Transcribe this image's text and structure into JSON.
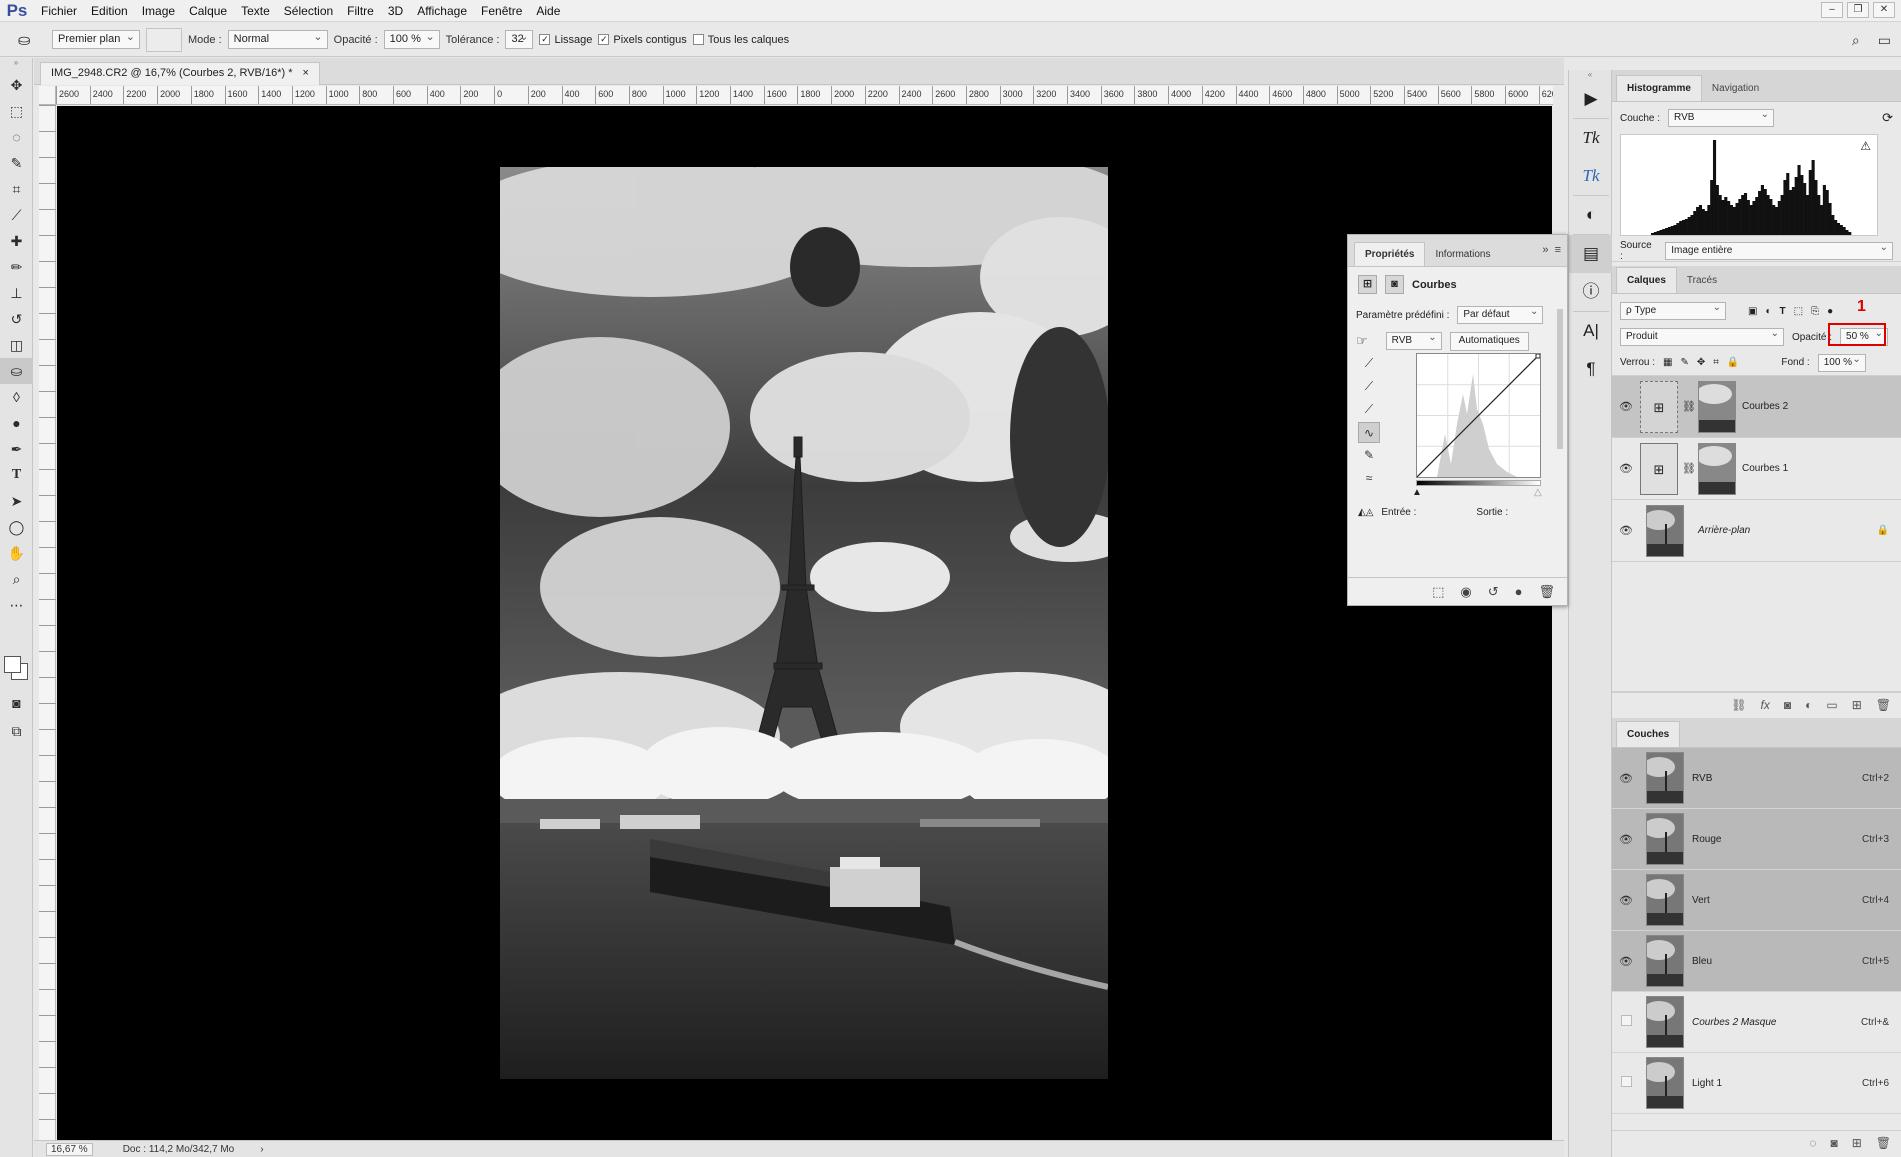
{
  "app": {
    "logo": "Ps",
    "menu": [
      "Fichier",
      "Edition",
      "Image",
      "Calque",
      "Texte",
      "Sélection",
      "Filtre",
      "3D",
      "Affichage",
      "Fenêtre",
      "Aide"
    ],
    "window_controls": [
      "–",
      "❐",
      "✕"
    ]
  },
  "options": {
    "fill_source": "Premier plan",
    "mode_label": "Mode :",
    "mode_value": "Normal",
    "opacity_label": "Opacité :",
    "opacity_value": "100 %",
    "tolerance_label": "Tolérance :",
    "tolerance_value": "32",
    "lissage": "Lissage",
    "pixels_contigus": "Pixels contigus",
    "tous_calques": "Tous les calques"
  },
  "document": {
    "tab_title": "IMG_2948.CR2 @ 16,7% (Courbes 2, RVB/16*) *",
    "close": "×",
    "ruler_labels": [
      "2600",
      "2400",
      "2200",
      "2000",
      "1800",
      "1600",
      "1400",
      "1200",
      "1000",
      "800",
      "600",
      "400",
      "200",
      "0",
      "200",
      "400",
      "600",
      "800",
      "1000",
      "1200",
      "1400",
      "1600",
      "1800",
      "2000",
      "2200",
      "2400",
      "2600",
      "2800",
      "3000",
      "3200",
      "3400",
      "3600",
      "3800",
      "4000",
      "4200",
      "4400",
      "4600",
      "4800",
      "5000",
      "5200",
      "5400",
      "5600",
      "5800",
      "6000",
      "620"
    ],
    "zoom": "16,67 %",
    "doc_info": "Doc : 114,2 Mo/342,7 Mo",
    "doc_arrow": "›"
  },
  "properties": {
    "tabs": [
      "Propriétés",
      "Informations"
    ],
    "title": "Courbes",
    "preset_label": "Paramètre prédéfini :",
    "preset_value": "Par défaut",
    "channel": "RVB",
    "auto_button": "Automatiques",
    "input_label": "Entrée :",
    "output_label": "Sortie :"
  },
  "histogram": {
    "tabs": [
      "Histogramme",
      "Navigation"
    ],
    "channel_label": "Couche :",
    "channel_value": "RVB",
    "source_label": "Source :",
    "source_value": "Image entière",
    "warning": "⚠",
    "bars": [
      2,
      3,
      4,
      5,
      6,
      7,
      8,
      9,
      10,
      12,
      14,
      15,
      16,
      18,
      20,
      24,
      28,
      30,
      26,
      24,
      30,
      55,
      95,
      50,
      40,
      35,
      38,
      34,
      30,
      28,
      32,
      36,
      40,
      42,
      35,
      30,
      34,
      38,
      44,
      50,
      46,
      40,
      36,
      30,
      28,
      34,
      40,
      55,
      62,
      45,
      48,
      58,
      70,
      60,
      52,
      40,
      65,
      75,
      55,
      40,
      30,
      50,
      45,
      32,
      20,
      15,
      12,
      10,
      8,
      5,
      3
    ]
  },
  "layers": {
    "tabs": [
      "Calques",
      "Tracés"
    ],
    "filter": "ρ Type",
    "blend_mode": "Produit",
    "opacity_label": "Opacité :",
    "opacity_value": "50 %",
    "lock_label": "Verrou :",
    "fill_label": "Fond :",
    "fill_value": "100 %",
    "items": [
      {
        "name": "Courbes 2",
        "selected": true
      },
      {
        "name": "Courbes 1",
        "selected": false
      },
      {
        "name": "Arrière-plan",
        "selected": false
      }
    ],
    "annotation_number": "1"
  },
  "channels": {
    "tab": "Couches",
    "items": [
      {
        "name": "RVB",
        "shortcut": "Ctrl+2",
        "visible": true,
        "selected": true
      },
      {
        "name": "Rouge",
        "shortcut": "Ctrl+3",
        "visible": true,
        "selected": true
      },
      {
        "name": "Vert",
        "shortcut": "Ctrl+4",
        "visible": true,
        "selected": true
      },
      {
        "name": "Bleu",
        "shortcut": "Ctrl+5",
        "visible": true,
        "selected": true
      },
      {
        "name": "Courbes 2 Masque",
        "shortcut": "Ctrl+&",
        "visible": false,
        "selected": false
      },
      {
        "name": "Light 1",
        "shortcut": "Ctrl+6",
        "visible": false,
        "selected": false
      }
    ]
  }
}
